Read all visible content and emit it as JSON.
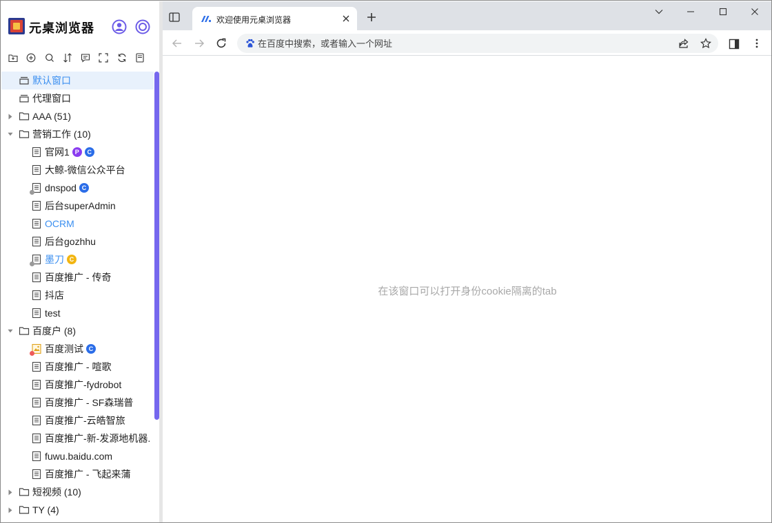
{
  "app": {
    "name": "元桌浏览器"
  },
  "sidebar": {
    "header": {
      "user_icon": "user-circle-icon",
      "target_icon": "target-ring-icon"
    },
    "toolbar": [
      {
        "icon": "new-folder-icon"
      },
      {
        "icon": "add-circle-icon"
      },
      {
        "icon": "search-icon"
      },
      {
        "icon": "sort-icon"
      },
      {
        "icon": "comment-icon"
      },
      {
        "icon": "fullscreen-icon"
      },
      {
        "icon": "refresh-icon"
      },
      {
        "icon": "bookmark-icon"
      }
    ],
    "tree": {
      "default_window": "默认窗口",
      "proxy_window": "代理窗口",
      "folder_aaa": "AAA (51)",
      "folder_marketing": "营销工作 (10)",
      "marketing_items": [
        "官网1",
        "大鲸-微信公众平台",
        "dnspod",
        "后台superAdmin",
        "OCRM",
        "后台gozhhu",
        "墨刀",
        "百度推广 - 传奇",
        "抖店",
        "test"
      ],
      "folder_baidu": "百度户 (8)",
      "baidu_items": [
        "百度测试",
        "百度推广 - 喧歌",
        "百度推广-fydrobot",
        "百度推广 - SF森瑞普",
        "百度推广-云皓智旅",
        "百度推广-新-发源地机器.",
        "fuwu.baidu.com",
        "百度推广 - 飞起来蒲"
      ],
      "folder_shortvideo": "短视频 (10)",
      "folder_ty": "TY (4)",
      "badges": {
        "p": "P",
        "c": "C"
      }
    }
  },
  "browser": {
    "tab": {
      "title": "欢迎使用元桌浏览器"
    },
    "omnibox": {
      "placeholder": "在百度中搜索，或者输入一个网址"
    },
    "content": {
      "hint": "在该窗口可以打开身份cookie隔离的tab"
    }
  },
  "colors": {
    "accent": "#7567ee",
    "link_blue": "#3b8ff0",
    "badge_purple": "#8a3cf0",
    "badge_blue": "#2b6de8",
    "badge_yellow": "#f2b511",
    "selected_bg": "#e8f1fc",
    "tabstrip_bg": "#dee1e6"
  }
}
